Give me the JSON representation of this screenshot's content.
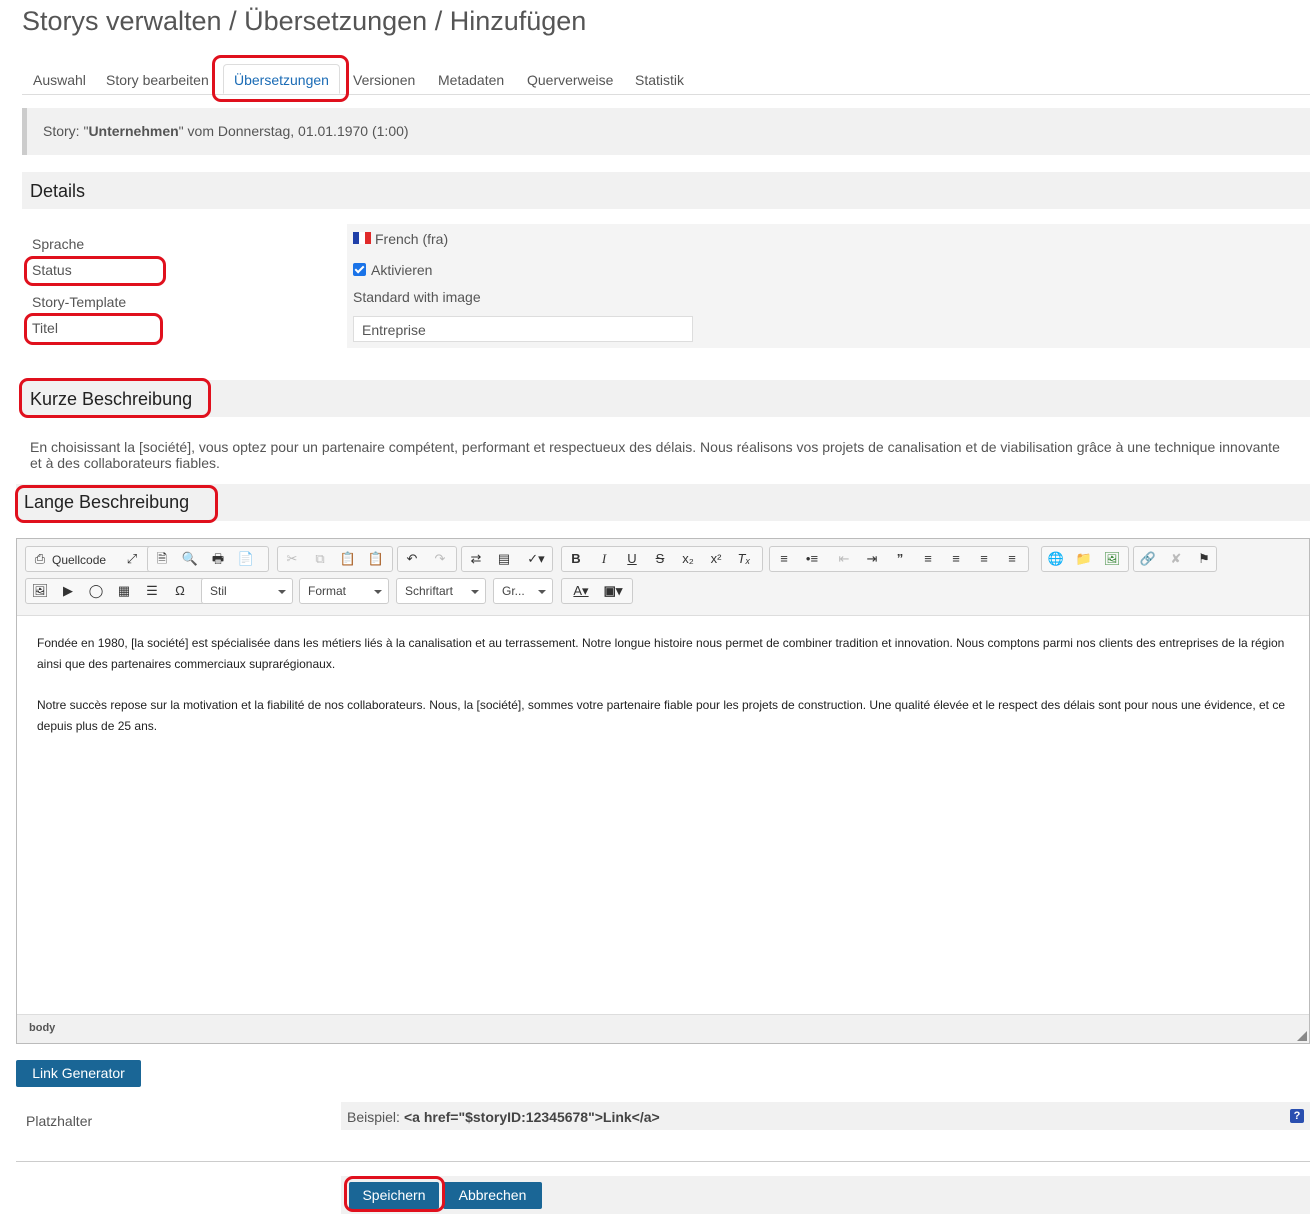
{
  "page_title": "Storys verwalten / Übersetzungen / Hinzufügen",
  "tabs": [
    {
      "label": "Auswahl"
    },
    {
      "label": "Story bearbeiten"
    },
    {
      "label": "Übersetzungen"
    },
    {
      "label": "Versionen"
    },
    {
      "label": "Metadaten"
    },
    {
      "label": "Querverweise"
    },
    {
      "label": "Statistik"
    }
  ],
  "active_tab": "Übersetzungen",
  "story_info": {
    "prefix": "Story: \"",
    "name": "Unternehmen",
    "suffix": "\" vom Donnerstag, 01.01.1970 (1:00)"
  },
  "details": {
    "heading": "Details",
    "sprache_label": "Sprache",
    "sprache_value": "French (fra)",
    "status_label": "Status",
    "status_checkbox_label": "Aktivieren",
    "status_checked": true,
    "template_label": "Story-Template",
    "template_value": "Standard with image",
    "titel_label": "Titel",
    "titel_value": "Entreprise"
  },
  "kurze": {
    "heading": "Kurze Beschreibung",
    "text": "En choisissant la [société], vous optez pour un partenaire compétent, performant et respectueux des délais. Nous réalisons vos projets de canalisation et de viabilisation grâce à une technique innovante et à des collaborateurs fiables."
  },
  "lange": {
    "heading": "Lange Beschreibung",
    "toolbar": {
      "source_label": "Quellcode",
      "combos": [
        "Stil",
        "Format",
        "Schriftart",
        "Gr..."
      ]
    },
    "paragraphs": [
      "Fondée en 1980, [la société] est spécialisée dans les métiers liés à la canalisation et au terrassement. Notre longue histoire nous permet de combiner tradition et innovation. Nous comptons parmi nos clients des entreprises de la région ainsi que des partenaires commerciaux suprarégionaux.",
      "Notre succès repose sur la motivation et la fiabilité de nos collaborateurs. Nous, la [société], sommes votre partenaire fiable pour les projets de construction. Une qualité élevée et le respect des délais sont pour nous une évidence, et ce depuis plus de 25 ans."
    ],
    "status_path": "body"
  },
  "link_generator_label": "Link Generator",
  "platzhalter": {
    "label": "Platzhalter",
    "example_prefix": "Beispiel: ",
    "example_code": "<a href=\"$storyID:12345678\">Link</a>"
  },
  "buttons": {
    "save": "Speichern",
    "cancel": "Abbrechen"
  },
  "colors": {
    "accent": "#1a6696",
    "highlight": "#e0101d",
    "active_tab_text": "#1a6bb5"
  }
}
